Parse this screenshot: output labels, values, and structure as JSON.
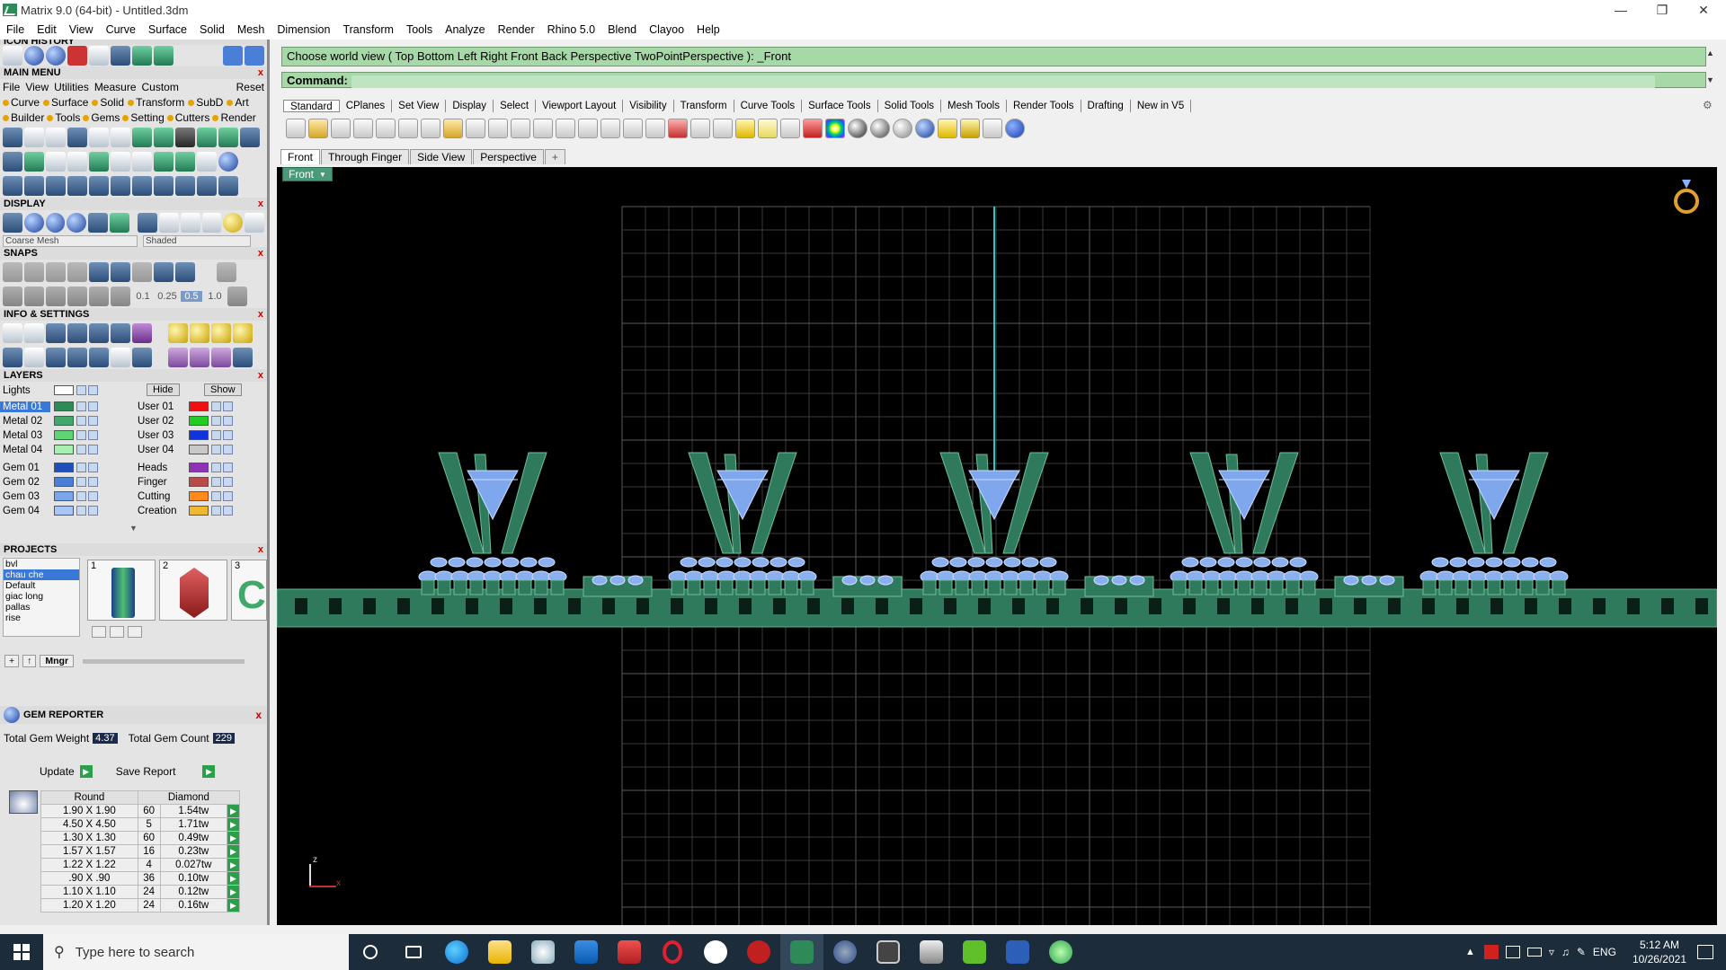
{
  "window": {
    "title": "Matrix 9.0 (64-bit) - Untitled.3dm"
  },
  "menubar": [
    "File",
    "Edit",
    "View",
    "Curve",
    "Surface",
    "Solid",
    "Mesh",
    "Dimension",
    "Transform",
    "Tools",
    "Analyze",
    "Render",
    "Rhino 5.0",
    "Blend",
    "Clayoo",
    "Help"
  ],
  "left": {
    "icon_history_title": "ICON HISTORY",
    "main_menu_title": "MAIN MENU",
    "main_menu_items": [
      "File",
      "View",
      "Utilities",
      "Measure",
      "Custom",
      "Reset"
    ],
    "module_row1": [
      "Curve",
      "Surface",
      "Solid",
      "Transform",
      "SubD",
      "Art"
    ],
    "module_row2": [
      "Builder",
      "Tools",
      "Gems",
      "Setting",
      "Cutters",
      "Render"
    ],
    "display_title": "DISPLAY",
    "display_mesh": "Coarse Mesh",
    "display_mode": "Shaded",
    "snaps_title": "SNAPS",
    "snap_values": [
      "0.1",
      "0.25",
      "0.5",
      "1.0"
    ],
    "info_title": "INFO & SETTINGS",
    "layers_title": "LAYERS",
    "layers_lights": "Lights",
    "layers_hide": "Hide",
    "layers_show": "Show",
    "layers_col1": [
      {
        "name": "Metal 01",
        "color": "#2e8b57",
        "selected": true
      },
      {
        "name": "Metal 02",
        "color": "#3fa86a"
      },
      {
        "name": "Metal 03",
        "color": "#5fd475"
      },
      {
        "name": "Metal 04",
        "color": "#a7f0b0"
      },
      {
        "name": "Gem 01",
        "color": "#1f4fb8"
      },
      {
        "name": "Gem 02",
        "color": "#4a7fd8"
      },
      {
        "name": "Gem 03",
        "color": "#7aa6ee"
      },
      {
        "name": "Gem 04",
        "color": "#a7c6f7"
      }
    ],
    "layers_col2": [
      {
        "name": "User 01",
        "color": "#ee1111"
      },
      {
        "name": "User 02",
        "color": "#22cc22"
      },
      {
        "name": "User 03",
        "color": "#1133dd"
      },
      {
        "name": "User 04",
        "color": "#c8c8c8"
      },
      {
        "name": "Heads",
        "color": "#8e33b8"
      },
      {
        "name": "Finger",
        "color": "#b84a4a"
      },
      {
        "name": "Cutting",
        "color": "#ff8a1a"
      },
      {
        "name": "Creation",
        "color": "#f0b830"
      }
    ],
    "projects_title": "PROJECTS",
    "projects_list": [
      "bvl",
      "chau che",
      "Default",
      "giac long",
      "pallas",
      "rise"
    ],
    "projects_selected": "chau che",
    "project_thumbs": [
      "1",
      "2",
      "3"
    ],
    "projects_mngr": "Mngr",
    "gem_title": "GEM REPORTER",
    "total_gem_weight_label": "Total Gem Weight",
    "total_gem_weight": "4.37",
    "total_gem_count_label": "Total Gem Count",
    "total_gem_count": "229",
    "update_label": "Update",
    "save_report_label": "Save Report",
    "gem_headers": [
      "Round",
      "Diamond"
    ],
    "gem_rows": [
      [
        "1.90 X 1.90",
        "60",
        "1.54tw"
      ],
      [
        "4.50 X 4.50",
        "5",
        "1.71tw"
      ],
      [
        "1.30 X 1.30",
        "60",
        "0.49tw"
      ],
      [
        "1.57 X 1.57",
        "16",
        "0.23tw"
      ],
      [
        "1.22 X 1.22",
        "4",
        "0.027tw"
      ],
      [
        ".90 X .90",
        "36",
        "0.10tw"
      ],
      [
        "1.10 X 1.10",
        "24",
        "0.12tw"
      ],
      [
        "1.20 X 1.20",
        "24",
        "0.16tw"
      ]
    ]
  },
  "command": {
    "prompt": "Choose world view ( Top  Bottom  Left  Right  Front  Back  Perspective  TwoPointPerspective ): _Front",
    "label": "Command:"
  },
  "toolbar_tabs": [
    "Standard",
    "CPlanes",
    "Set View",
    "Display",
    "Select",
    "Viewport Layout",
    "Visibility",
    "Transform",
    "Curve Tools",
    "Surface Tools",
    "Solid Tools",
    "Mesh Tools",
    "Render Tools",
    "Drafting",
    "New in V5"
  ],
  "viewport_tabs": [
    "Front",
    "Through Finger",
    "Side View",
    "Perspective"
  ],
  "viewport_add": "+",
  "viewport": {
    "label": "Front",
    "axis_x": "x",
    "axis_z": "z"
  },
  "taskbar": {
    "search_placeholder": "Type here to search",
    "lang": "ENG",
    "time": "5:12 AM",
    "date": "10/26/2021"
  }
}
